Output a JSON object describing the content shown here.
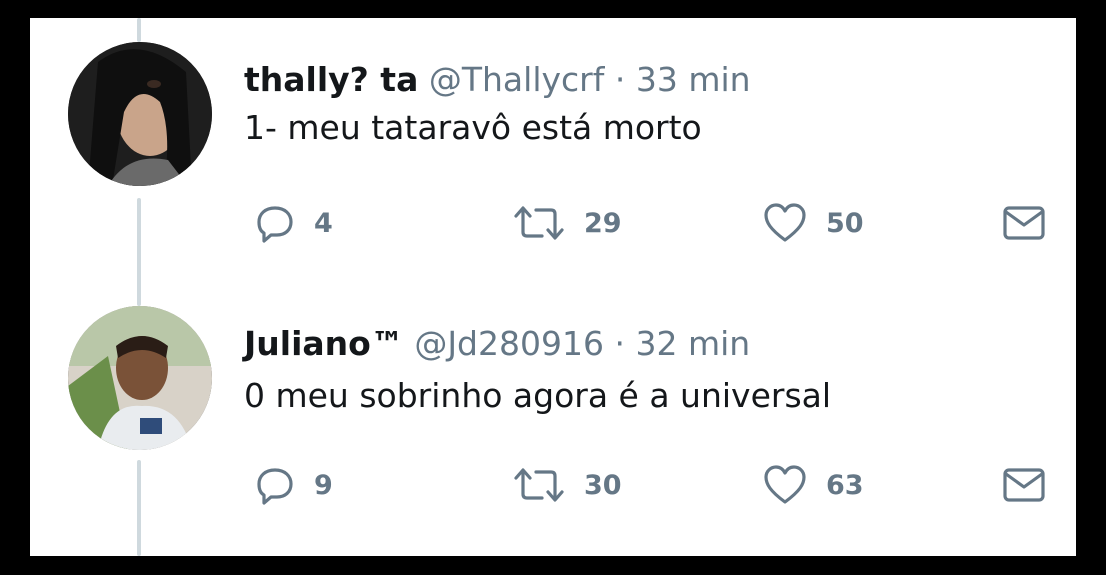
{
  "tweets": [
    {
      "name": "thally? ta",
      "handle": "@Thallycrf",
      "separator": "·",
      "time": "33 min",
      "text": "1- meu tataravô está morto",
      "replies": "4",
      "retweets": "29",
      "likes": "50",
      "avatar_color": "#2b2b2b"
    },
    {
      "name": "Juliano™",
      "handle": "@Jd280916",
      "separator": "·",
      "time": "32 min",
      "text": "0 meu sobrinho agora é a universal",
      "replies": "9",
      "retweets": "30",
      "likes": "63",
      "avatar_color": "#9b8a76"
    }
  ],
  "icons": {
    "reply": "reply-icon",
    "retweet": "retweet-icon",
    "like": "like-icon",
    "message": "message-icon"
  },
  "colors": {
    "text": "#14171a",
    "muted": "#657786",
    "thread_line": "#cfd9de"
  }
}
